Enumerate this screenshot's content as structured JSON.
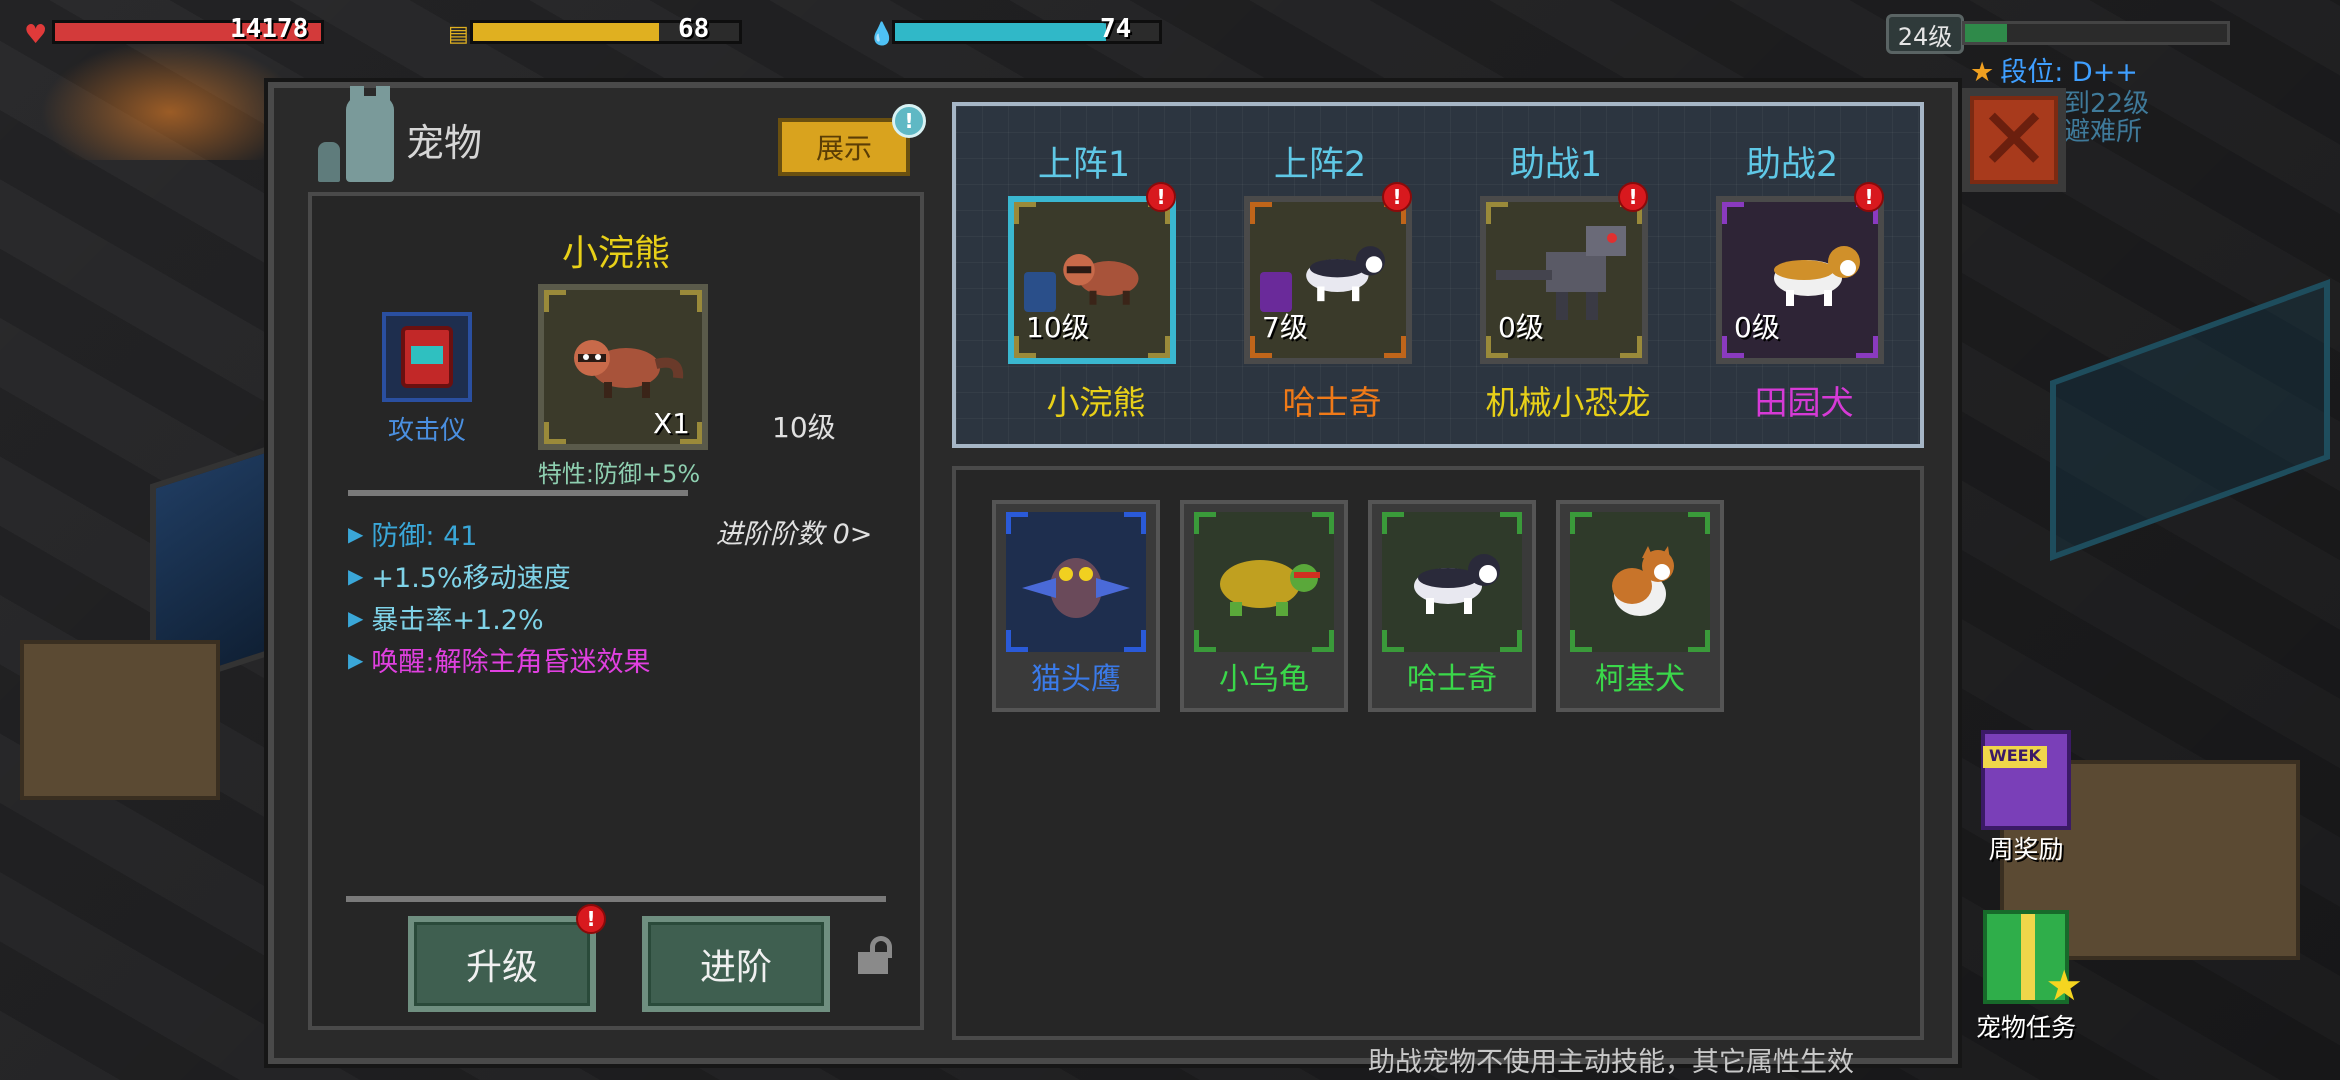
{
  "hud": {
    "hp": "14178",
    "energy": "68",
    "mana": "74",
    "hp_fill": 1.0,
    "energy_fill": 0.7,
    "mana_fill": 0.8,
    "colors": {
      "hp": "#d33a3a",
      "energy": "#e0b020",
      "mana": "#30b8c8"
    }
  },
  "player": {
    "level": "24级",
    "xp_fill": 0.16,
    "rank": "段位: D++",
    "hint_line1": "到22级",
    "hint_line2": "避难所"
  },
  "panel": {
    "title": "宠物",
    "show_button": "展示",
    "info_mark": "!",
    "alert_mark": "!"
  },
  "detail": {
    "pet_name": "小浣熊",
    "gadget_label": "攻击仪",
    "count": "X1",
    "level": "10级",
    "trait": "特性:防御+5%",
    "stats": [
      {
        "text": "防御: 41",
        "color": "#3aa7d8"
      },
      {
        "text": "+1.5%移动速度",
        "color": "#7fd3e8"
      },
      {
        "text": "暴击率+1.2%",
        "color": "#7fd3e8"
      },
      {
        "text": "唤醒:解除主角昏迷效果",
        "color": "#e040e0"
      }
    ],
    "advance_count": "进阶阶数 0>",
    "upgrade_button": "升级",
    "advance_button": "进阶"
  },
  "team": [
    {
      "slot": "上阵1",
      "level": "10级",
      "name": "小浣熊",
      "name_color": "#e8d018",
      "frame": "#9a8a3a",
      "pet": "raccoon"
    },
    {
      "slot": "上阵2",
      "level": "7级",
      "name": "哈士奇",
      "name_color": "#f07a18",
      "frame": "#c0651a",
      "pet": "husky"
    },
    {
      "slot": "助战1",
      "level": "0级",
      "name": "机械小恐龙",
      "name_color": "#e8d018",
      "frame": "#9a8a3a",
      "pet": "mech-dino"
    },
    {
      "slot": "助战2",
      "level": "0级",
      "name": "田园犬",
      "name_color": "#d63ad6",
      "frame": "#8a3ac0",
      "pet": "dog"
    }
  ],
  "pets": [
    {
      "name": "猫头鹰",
      "name_color": "#3a7ae8",
      "frame": "#2a5ad8",
      "bg": "#1e2e4e",
      "pet": "owl"
    },
    {
      "name": "小乌龟",
      "name_color": "#3ad84a",
      "frame": "#3a9a3a",
      "bg": "#2f3a2a",
      "pet": "turtle"
    },
    {
      "name": "哈士奇",
      "name_color": "#3ad84a",
      "frame": "#3a9a3a",
      "bg": "#2f3a2a",
      "pet": "husky"
    },
    {
      "name": "柯基犬",
      "name_color": "#3ad84a",
      "frame": "#3a9a3a",
      "bg": "#2f3a2a",
      "pet": "corgi"
    }
  ],
  "footer_note": "助战宠物不使用主动技能，其它属性生效",
  "side": {
    "weekly_label": "周奖励",
    "weekly_tag": "WEEK",
    "pet_task_label": "宠物任务"
  }
}
